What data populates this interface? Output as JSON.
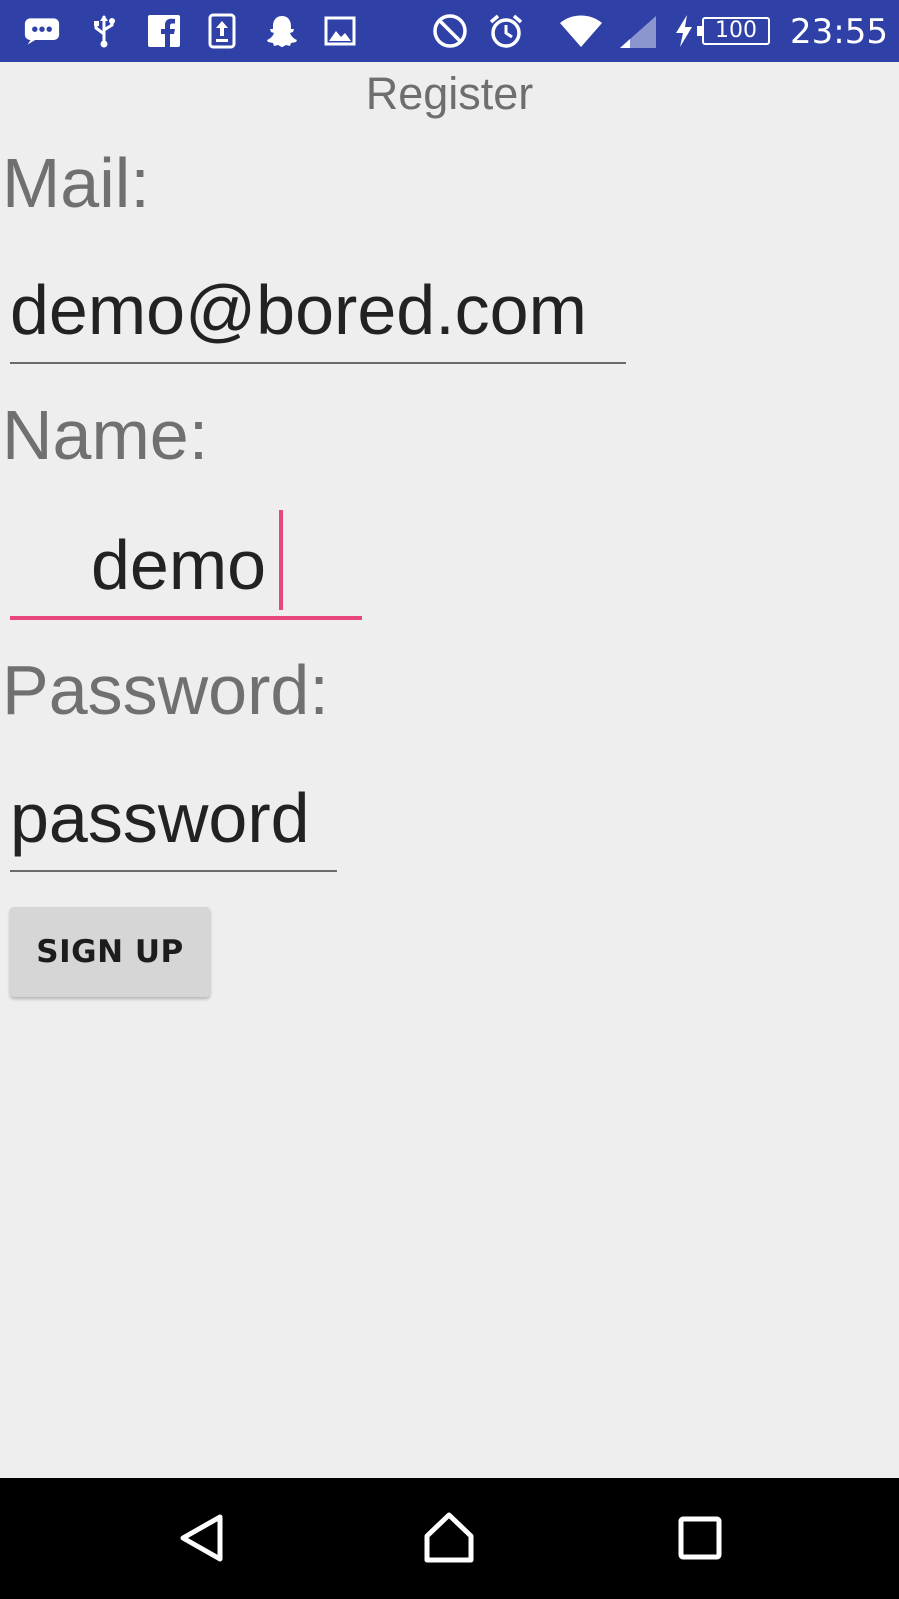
{
  "status_bar": {
    "time": "23:55",
    "battery": "100",
    "icons": [
      "message-icon",
      "usb-icon",
      "facebook-icon",
      "upload-icon",
      "snapchat-icon",
      "image-icon",
      "do-not-disturb-icon",
      "alarm-icon",
      "wifi-icon",
      "signal-icon",
      "charging-icon",
      "battery-icon"
    ]
  },
  "header": {
    "title": "Register"
  },
  "form": {
    "mail_label": "Mail:",
    "mail_value": "demo@bored.com",
    "name_label": "Name:",
    "name_value": "demo",
    "password_label": "Password:",
    "password_value": "password",
    "signup_label": "SIGN UP"
  },
  "nav_bar": {
    "icons": [
      "back-icon",
      "home-icon",
      "recents-icon"
    ]
  },
  "colors": {
    "status_bar": "#2f41a6",
    "accent": "#e9467f",
    "background": "#eeeeee"
  }
}
